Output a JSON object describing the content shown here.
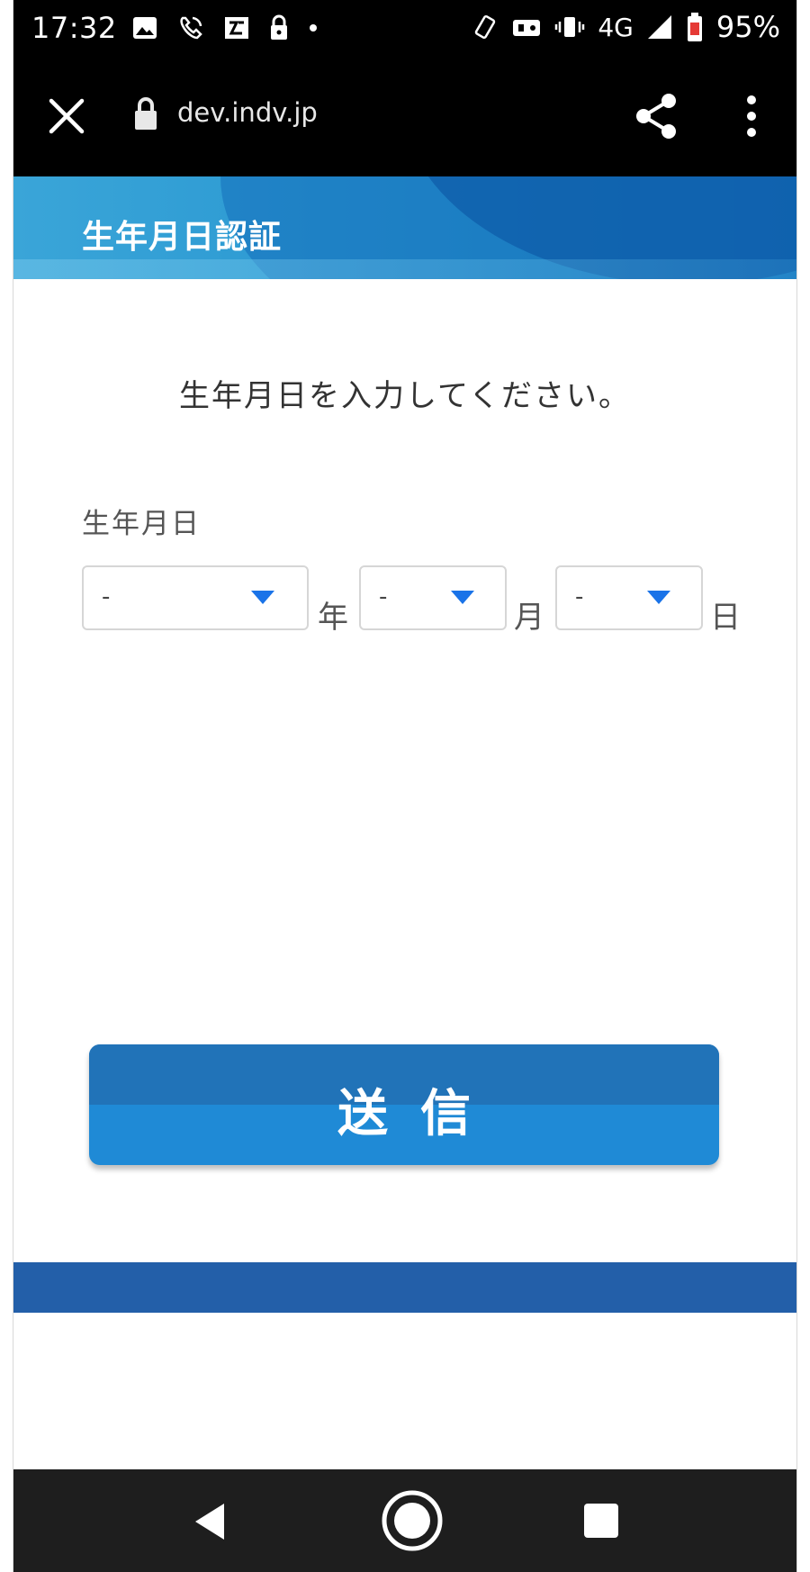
{
  "status_bar": {
    "time": "17:32",
    "network": "4G",
    "battery": "95%",
    "icons_left": [
      "image-icon",
      "call-icon",
      "news-icon",
      "lock-icon",
      "dot-icon"
    ],
    "icons_right": [
      "rotate-icon",
      "game-icon",
      "vibrate-icon",
      "signal-icon",
      "battery-icon"
    ]
  },
  "browser": {
    "url": "dev.indv.jp",
    "icons": [
      "close-icon",
      "lock-icon",
      "share-icon",
      "more-vert-icon"
    ]
  },
  "header": {
    "title": "生年月日認証"
  },
  "form": {
    "instruction": "生年月日を入力してください。",
    "dob_label": "生年月日",
    "year": {
      "value": "-",
      "unit": "年"
    },
    "month": {
      "value": "-",
      "unit": "月"
    },
    "day": {
      "value": "-",
      "unit": "日"
    }
  },
  "submit": {
    "label": "送信"
  },
  "nav": {
    "icons": [
      "back-icon",
      "home-icon",
      "recents-icon"
    ]
  },
  "colors": {
    "header": "#2a98d2",
    "button": "#1f8ad6",
    "button_top": "#2173b8",
    "footer_band": "#235fa9",
    "select_arrow": "#1a73e8"
  }
}
